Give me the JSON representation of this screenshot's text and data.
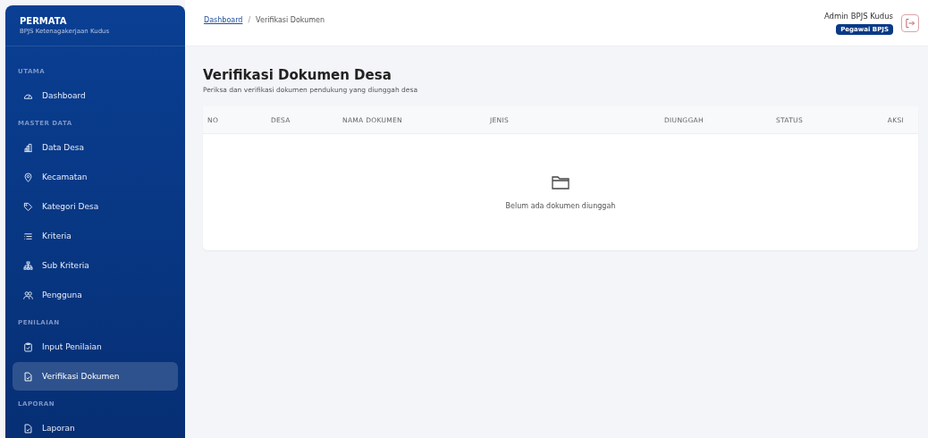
{
  "sidebar": {
    "brand": "PERMATA",
    "subtitle": "BPJS Ketenagakerjaan Kudus",
    "sections": [
      {
        "title": "UTAMA",
        "items": [
          {
            "label": "Dashboard",
            "kind": "gauge",
            "selected": false
          }
        ]
      },
      {
        "title": "MASTER DATA",
        "items": [
          {
            "label": "Data Desa",
            "kind": "chart",
            "selected": false
          },
          {
            "label": "Kecamatan",
            "kind": "pin",
            "selected": false
          },
          {
            "label": "Kategori Desa",
            "kind": "tag",
            "selected": false
          },
          {
            "label": "Kriteria",
            "kind": "list",
            "selected": false
          },
          {
            "label": "Sub Kriteria",
            "kind": "tree",
            "selected": false
          },
          {
            "label": "Pengguna",
            "kind": "users",
            "selected": false
          }
        ]
      },
      {
        "title": "PENILAIAN",
        "items": [
          {
            "label": "Input Penilaian",
            "kind": "clipboard",
            "selected": false
          },
          {
            "label": "Verifikasi Dokumen",
            "kind": "doc",
            "selected": true
          }
        ]
      },
      {
        "title": "LAPORAN",
        "items": [
          {
            "label": "Laporan",
            "kind": "doc",
            "selected": false
          }
        ]
      }
    ]
  },
  "breadcrumb": {
    "separator": "/",
    "items": [
      {
        "label": "Dashboard",
        "link": true
      },
      {
        "label": "Verifikasi Dokumen",
        "link": false
      }
    ]
  },
  "user": {
    "name": "Admin BPJS Kudus",
    "role": "Pegawai BPJS"
  },
  "page": {
    "title": "Verifikasi Dokumen Desa",
    "subtitle": "Periksa dan verifikasi dokumen pendukung yang diunggah desa"
  },
  "table": {
    "columns": [
      "NO",
      "DESA",
      "NAMA DOKUMEN",
      "JENIS",
      "DIUNGGAH",
      "STATUS",
      "AKSI"
    ],
    "empty_message": "Belum ada dokumen diunggah"
  }
}
